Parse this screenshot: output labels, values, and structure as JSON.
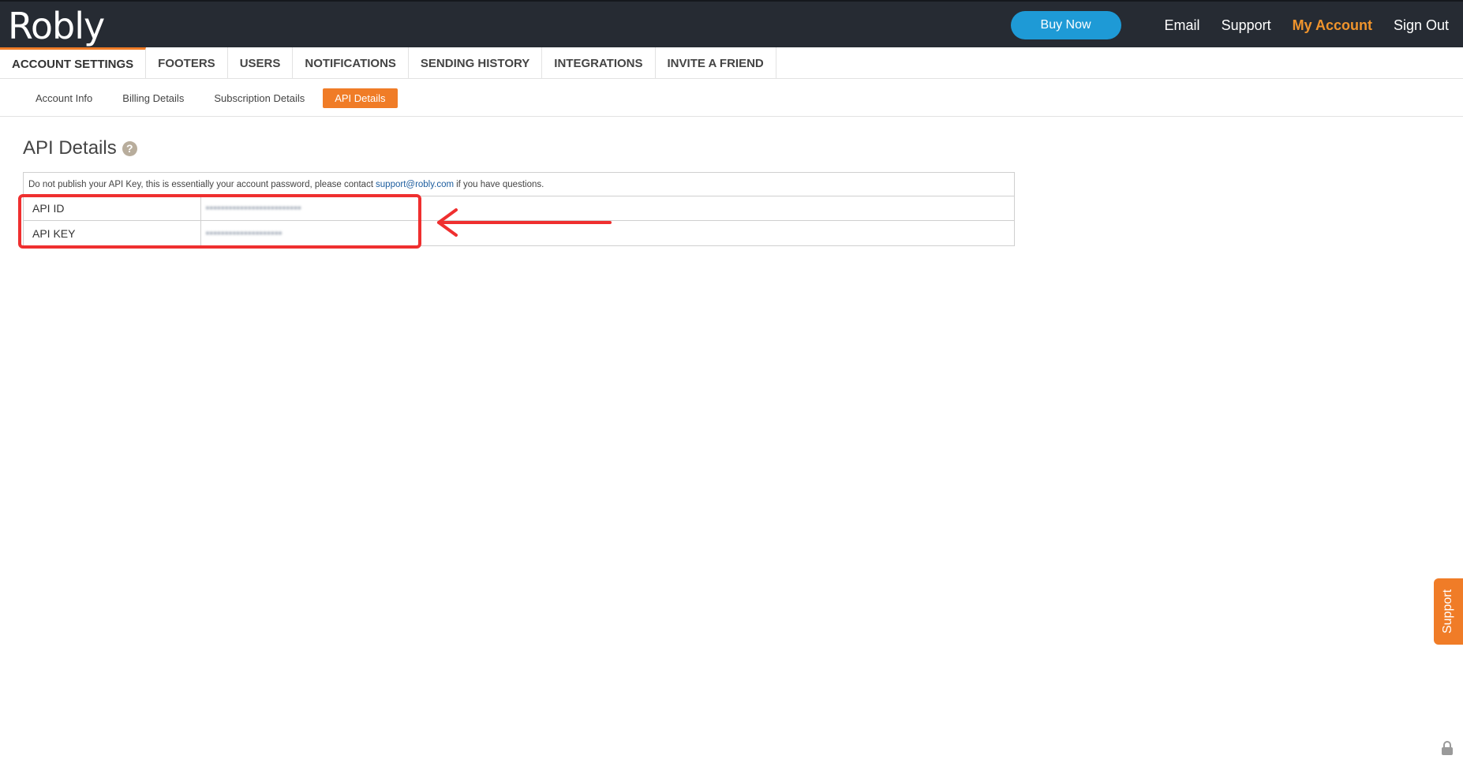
{
  "header": {
    "logo": "Robly",
    "buy_button": "Buy Now",
    "nav": [
      "Email",
      "Support",
      "My Account",
      "Sign Out"
    ],
    "active_nav": "My Account"
  },
  "tabs": [
    "ACCOUNT SETTINGS",
    "FOOTERS",
    "USERS",
    "NOTIFICATIONS",
    "SENDING HISTORY",
    "INTEGRATIONS",
    "INVITE A FRIEND"
  ],
  "subtabs": [
    "Account Info",
    "Billing Details",
    "Subscription Details",
    "API Details"
  ],
  "page": {
    "title": "API Details",
    "notice_before": "Do not publish your API Key, this is essentially your account password, please contact",
    "notice_email": "support@robly.com",
    "notice_after": "if you have questions.",
    "rows": [
      {
        "label": "API ID",
        "value": "•••••••••••••••••••••••••"
      },
      {
        "label": "API KEY",
        "value": "••••••••••••••••••••"
      }
    ]
  },
  "support_tab": "Support",
  "colors": {
    "topbar": "#262b33",
    "accent_orange": "#f07c27",
    "buy_blue": "#1e9ad6",
    "annotation_red": "#ef2f2f"
  },
  "icons": [
    "help-icon",
    "lock-icon",
    "arrow-left-icon"
  ]
}
